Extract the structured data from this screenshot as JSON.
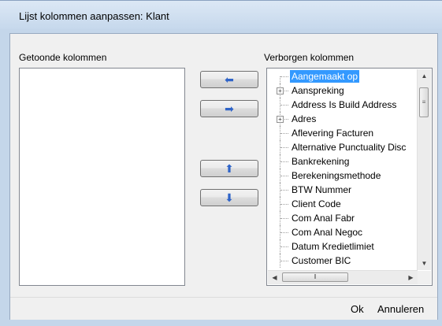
{
  "window": {
    "title": "Lijst kolommen aanpassen: Klant"
  },
  "shown": {
    "label": "Getoonde kolommen",
    "items": []
  },
  "hidden": {
    "label": "Verborgen kolommen",
    "items": [
      {
        "label": "Aangemaakt op",
        "expandable": false,
        "selected": true
      },
      {
        "label": "Aanspreking",
        "expandable": true,
        "selected": false
      },
      {
        "label": "Address Is Build Address",
        "expandable": false,
        "selected": false
      },
      {
        "label": "Adres",
        "expandable": true,
        "selected": false
      },
      {
        "label": "Aflevering Facturen",
        "expandable": false,
        "selected": false
      },
      {
        "label": "Alternative Punctuality Disc",
        "expandable": false,
        "selected": false
      },
      {
        "label": "Bankrekening",
        "expandable": false,
        "selected": false
      },
      {
        "label": "Berekeningsmethode",
        "expandable": false,
        "selected": false
      },
      {
        "label": "BTW Nummer",
        "expandable": false,
        "selected": false
      },
      {
        "label": "Client Code",
        "expandable": false,
        "selected": false
      },
      {
        "label": "Com Anal Fabr",
        "expandable": false,
        "selected": false
      },
      {
        "label": "Com Anal Negoc",
        "expandable": false,
        "selected": false
      },
      {
        "label": "Datum Kredietlimiet",
        "expandable": false,
        "selected": false
      },
      {
        "label": "Customer BIC",
        "expandable": false,
        "selected": false
      }
    ]
  },
  "buttons": {
    "move_left_icon": "arrow-left-icon",
    "move_right_icon": "arrow-right-icon",
    "move_up_icon": "arrow-up-icon",
    "move_down_icon": "arrow-down-icon"
  },
  "footer": {
    "ok_label": "Ok",
    "cancel_label": "Annuleren"
  },
  "colors": {
    "selection": "#3399ff",
    "arrow": "#2f64c8"
  }
}
